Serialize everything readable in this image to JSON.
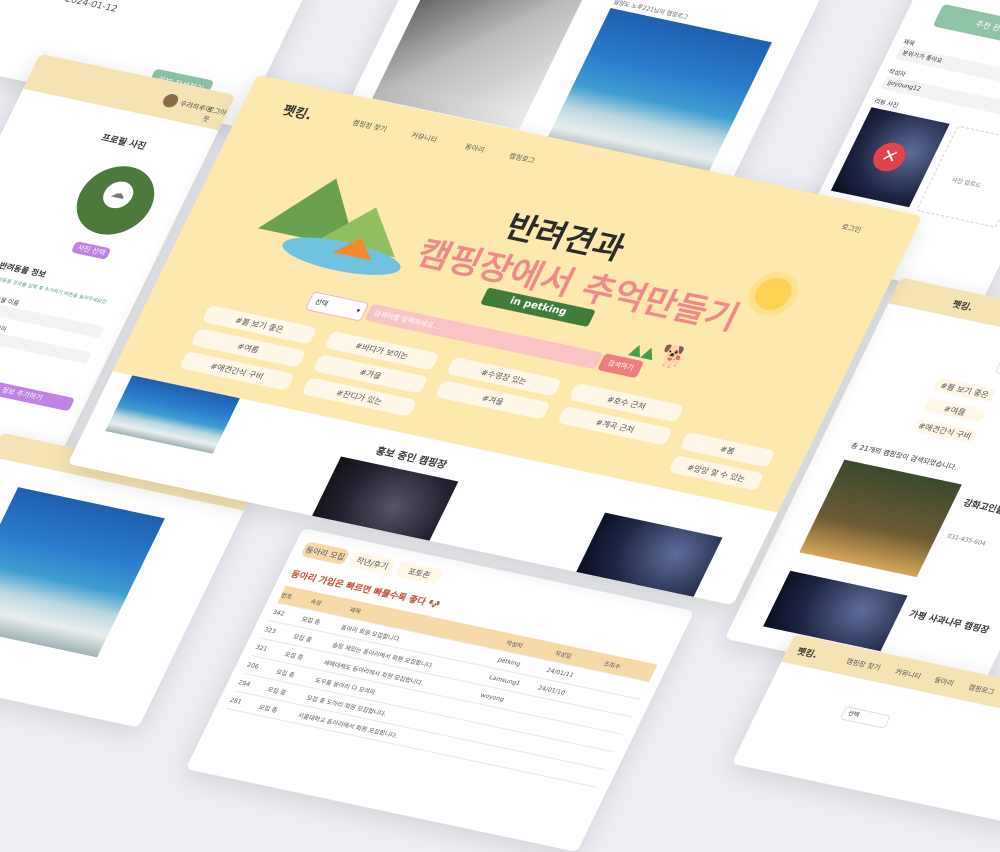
{
  "brand": "펫킹.",
  "nav": {
    "items": [
      "캠핑장 찾기",
      "커뮤니티",
      "동아리",
      "캠핑로그"
    ],
    "login": "로그인"
  },
  "hero": {
    "line1": "반려견과",
    "line2": "캠핑장에서 추억만들기",
    "ribbon": "in petking"
  },
  "search": {
    "select_label": "선택",
    "placeholder": "검색어를 입력하세요...",
    "button": "검색하기"
  },
  "tags_main": [
    "#불 보기 좋은",
    "#바다가 보이는",
    "#수영장 있는",
    "#호수 근처",
    "#여름",
    "#가을",
    "#겨울",
    "#계곡 근처",
    "#봄",
    "#애견간식 구비",
    "#잔디가 있는",
    "#망망 할 수 있는"
  ],
  "promo": {
    "title": "홍보 중인 캠핑장"
  },
  "profile": {
    "title": "프로필 사진",
    "upload": "사진 업로드",
    "select_photo": "사진 선택",
    "pet_info": "반려동물 정보",
    "notice": "반려동물 정보를 입력 후 추가하기 버튼을 눌러주세요😊",
    "name_label": "반려동물 이름",
    "age_label": "반려동물 나이",
    "save_button": "반려동물 정보 추가하기",
    "user": "우려하루어",
    "login": "로그아웃"
  },
  "review": {
    "date": "2024-01-12",
    "button": "리뷰 작성하기"
  },
  "camplog": {
    "caption": "월량도 노루221님의 캠핑로그"
  },
  "right_form": {
    "submit": "추천 완료",
    "title_label": "제목",
    "title_value": "분위기가 좋아요",
    "author_label": "작성자",
    "author_value": "jjoyoung12",
    "photo_label": "리뷰 사진",
    "photo_upload": "사진 업로드"
  },
  "results": {
    "summary": "총 21개의 캠핑장이 검색되었습니다.",
    "item1_name": "강화고인돌",
    "item1_phone": "031-435-604",
    "item2_name": "가평 사과나무 캠핑장",
    "select_label": "선택",
    "tag1": "#불 보기 좋은",
    "tag2": "#여름",
    "tag3": "#애견간식 구비"
  },
  "club": {
    "tabs": [
      "동아리 모집",
      "작년/후기",
      "포토존"
    ],
    "headline": "동아리 가입은 빠르면 빠를수록 좋다 🐶",
    "cols": [
      "번호",
      "속성",
      "제목",
      "작성자",
      "작성일",
      "조회수"
    ],
    "rows": [
      [
        "342",
        "모집 중",
        "동아리 회원 모집합니다."
      ],
      [
        "323",
        "모집 중",
        "슬링 재밌는 동아리에서 회원 모집합니다."
      ],
      [
        "321",
        "모집 중",
        "새해대해도 동아리에서 회원 모집합니다."
      ],
      [
        "206",
        "모집 중",
        "도우들 동아리 다 모여라"
      ],
      [
        "294",
        "모집 중",
        "모집 중 도아리 회원 모집합니다."
      ],
      [
        "281",
        "모집 중",
        "서울대학교 동아리에서 회원 모집합니다."
      ]
    ],
    "authors": [
      "petking",
      "Lamsung1",
      "woyong"
    ],
    "dates": [
      "24/01/11",
      "24/01/10"
    ]
  },
  "bottom_nav": {
    "items": [
      "캠핑장 찾기",
      "커뮤니티",
      "동아리",
      "캠핑로그"
    ],
    "select_label": "선택"
  },
  "colors": {
    "yellow": "#fde9ad",
    "green": "#8ec3a6",
    "purple": "#c182e6",
    "pink": "#f5a3a3"
  }
}
